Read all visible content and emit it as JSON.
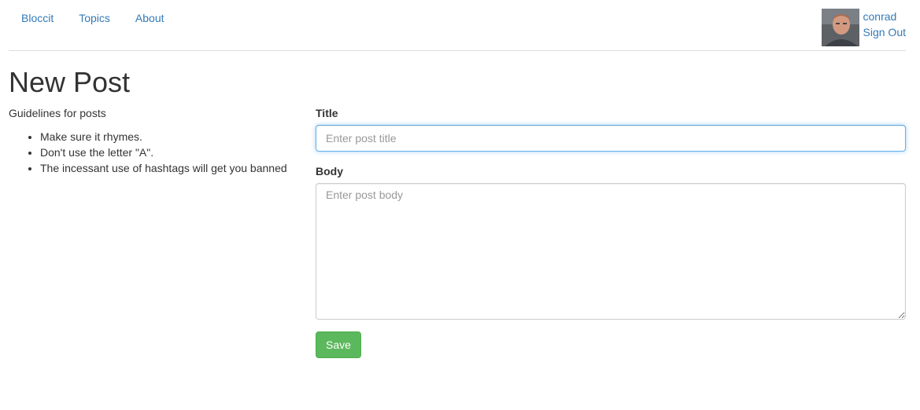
{
  "colors": {
    "link": "#337ab7",
    "text": "#333333",
    "success": "#5cb85c",
    "focus_border": "#66afe9"
  },
  "nav": {
    "links": [
      "Bloccit",
      "Topics",
      "About"
    ]
  },
  "user": {
    "name": "conrad",
    "sign_out_label": "Sign Out",
    "avatar_icon": "user-avatar-photo"
  },
  "page": {
    "title": "New Post"
  },
  "guidelines": {
    "heading": "Guidelines for posts",
    "items": [
      "Make sure it rhymes.",
      "Don't use the letter \"A\".",
      "The incessant use of hashtags will get you banned"
    ]
  },
  "form": {
    "title_label": "Title",
    "title_placeholder": "Enter post title",
    "title_value": "",
    "body_label": "Body",
    "body_placeholder": "Enter post body",
    "body_value": "",
    "save_label": "Save"
  }
}
